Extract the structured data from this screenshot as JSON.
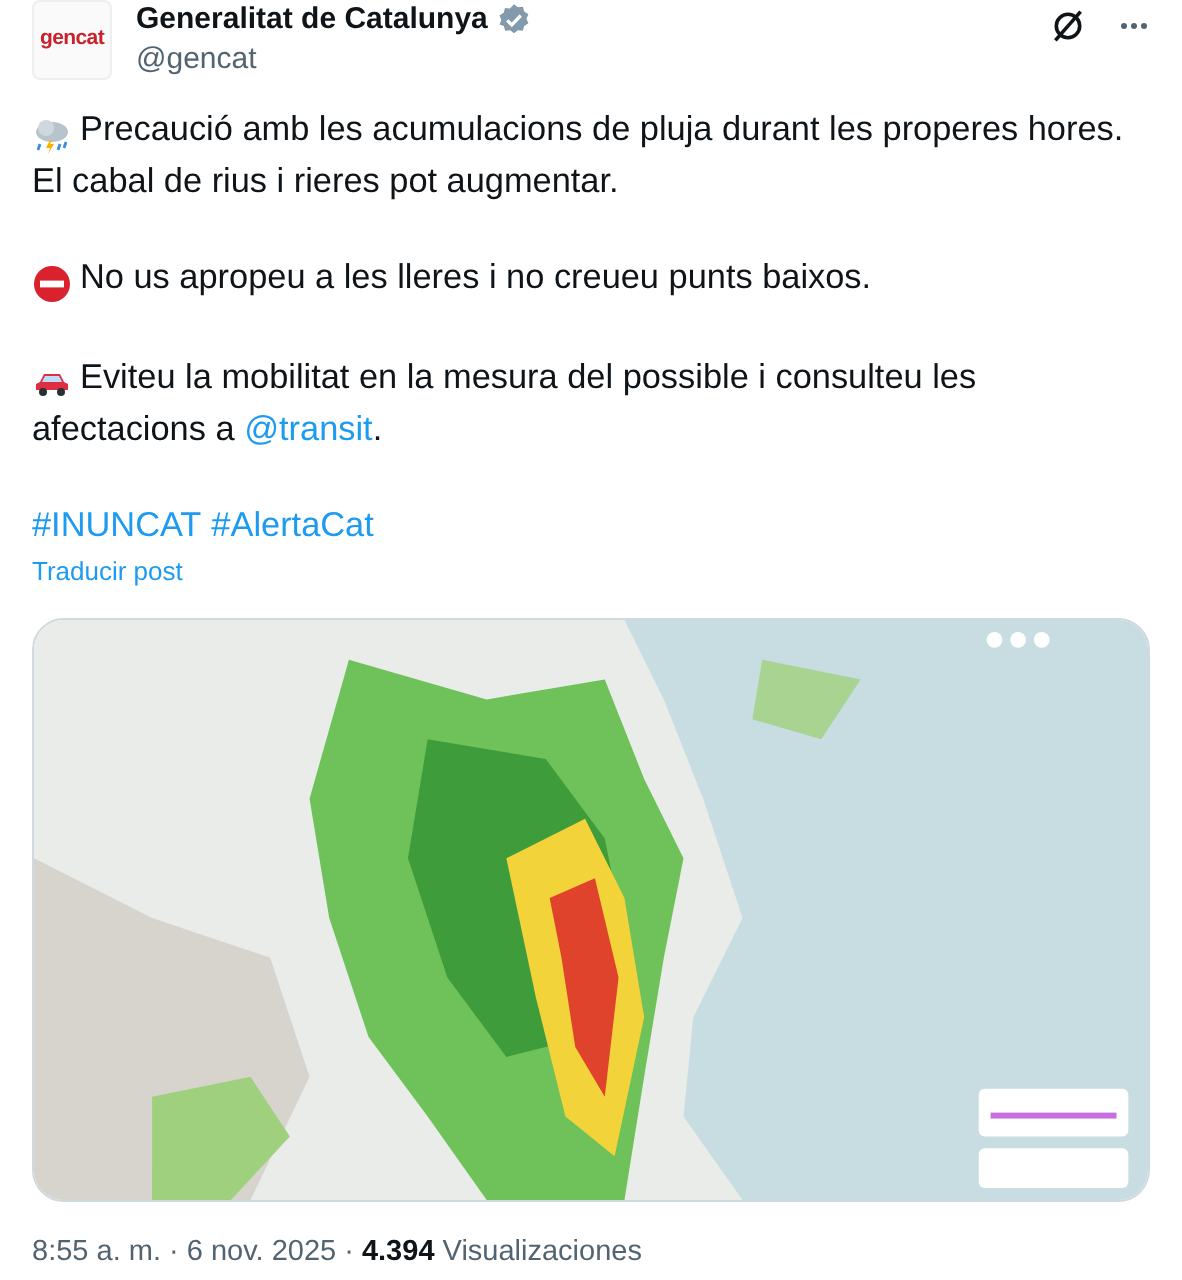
{
  "author": {
    "name": "Generalitat de Catalunya",
    "handle": "@gencat",
    "verified": true,
    "avatar_text": "gencat"
  },
  "paragraphs": [
    {
      "kind": "storm",
      "parts": [
        {
          "kind": "plain",
          "text": "Precaució amb les acumulacions de pluja durant les properes hores.\nEl cabal de rius i rieres pot augmentar."
        }
      ]
    },
    {
      "kind": "no-entry",
      "parts": [
        {
          "kind": "plain",
          "text": "No us apropeu a les lleres i no creueu punts baixos."
        }
      ]
    },
    {
      "kind": "car",
      "parts": [
        {
          "kind": "plain",
          "text": "Eviteu la mobilitat en la mesura del possible i consulteu les afectacions a "
        },
        {
          "kind": "link",
          "text": "@transit"
        },
        {
          "kind": "plain",
          "text": "."
        }
      ]
    },
    {
      "kind": "none",
      "parts": [
        {
          "kind": "link",
          "text": "#INUNCAT"
        },
        {
          "kind": "link",
          "text": "#AlertaCat"
        }
      ]
    }
  ],
  "translate_link": "Traducir post",
  "meta": "8:55 a. m. · 6 nov. 2025 · **4.394** Visualizaciones"
}
